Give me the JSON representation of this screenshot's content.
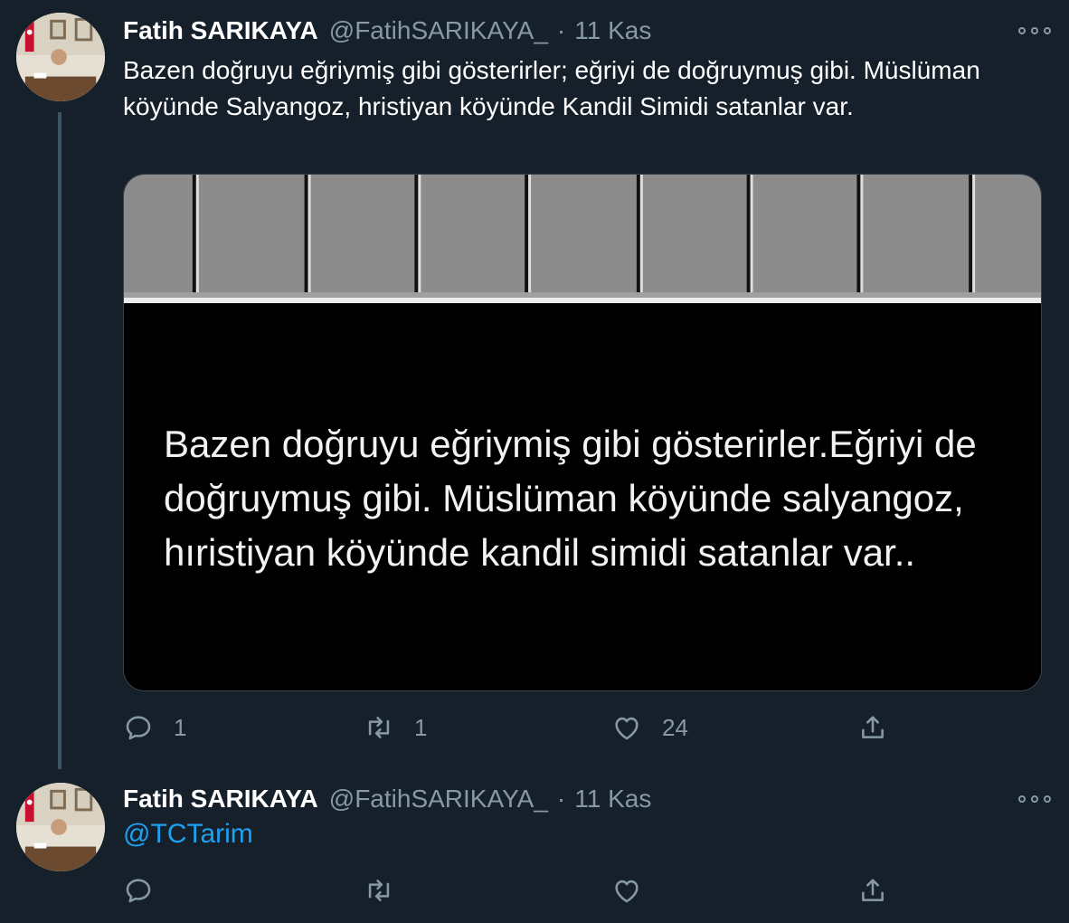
{
  "tweets": [
    {
      "author": {
        "name": "Fatih SARIKAYA",
        "handle": "@FatihSARIKAYA_"
      },
      "date_separator": "·",
      "date": "11 Kas",
      "text": "Bazen doğruyu eğriymiş gibi gösterirler; eğriyi de doğruymuş gibi. Müslüman köyünde Salyangoz, hristiyan köyünde Kandil Simidi satanlar var.",
      "media": {
        "text": "Bazen doğruyu eğriymiş gibi gösterirler.Eğriyi de doğruymuş gibi. Müslüman köyünde salyangoz, hıristiyan köyünde kandil simidi satanlar var.."
      },
      "actions": {
        "reply_icon": "reply-icon",
        "reply_count": "1",
        "retweet_icon": "retweet-icon",
        "retweet_count": "1",
        "like_icon": "like-icon",
        "like_count": "24",
        "share_icon": "share-icon"
      }
    },
    {
      "author": {
        "name": "Fatih SARIKAYA",
        "handle": "@FatihSARIKAYA_"
      },
      "date_separator": "·",
      "date": "11 Kas",
      "mention": "@TCTarim",
      "actions": {
        "reply_icon": "reply-icon",
        "retweet_icon": "retweet-icon",
        "like_icon": "like-icon",
        "share_icon": "share-icon"
      }
    }
  ],
  "colors": {
    "background": "#15202b",
    "secondary_text": "#8899a6",
    "link": "#1da1f2",
    "thread_line": "#3d5466"
  }
}
